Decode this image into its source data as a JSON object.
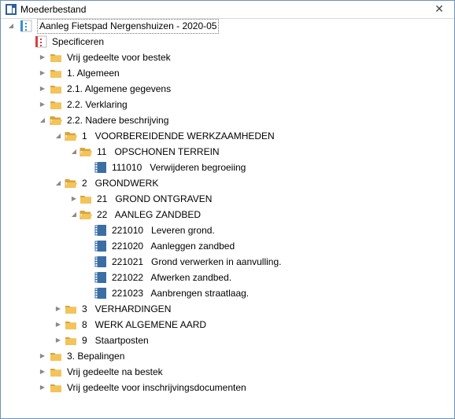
{
  "window": {
    "title": "Moederbestand",
    "close_glyph": "✕"
  },
  "tree": [
    {
      "id": "r0",
      "label": "Aanleg Fietspad Nergenshuizen - 2020-05",
      "icon": "project-doc-icon",
      "arrow": "expanded",
      "level": 0
    },
    {
      "id": "r1",
      "label": "Specificeren",
      "icon": "specification-icon",
      "arrow": "none",
      "level": 1
    },
    {
      "id": "r2",
      "label": "Vrij gedeelte voor bestek",
      "icon": "folder-icon",
      "arrow": "collapsed",
      "level": 2
    },
    {
      "id": "r3",
      "label": "1. Algemeen",
      "icon": "folder-icon",
      "arrow": "collapsed",
      "level": 2
    },
    {
      "id": "r4",
      "label": "2.1. Algemene gegevens",
      "icon": "folder-icon",
      "arrow": "collapsed",
      "level": 2
    },
    {
      "id": "r5",
      "label": "2.2. Verklaring",
      "icon": "folder-icon",
      "arrow": "collapsed",
      "level": 2
    },
    {
      "id": "r6",
      "label": "2.2. Nadere beschrijving",
      "icon": "folder-open-icon",
      "arrow": "expanded",
      "level": 2
    },
    {
      "id": "r7",
      "label": "1   VOORBEREIDENDE WERKZAAMHEDEN",
      "icon": "folder-open-icon",
      "arrow": "expanded",
      "level": 3
    },
    {
      "id": "r8",
      "label": "11   OPSCHONEN TERREIN",
      "icon": "folder-open-icon",
      "arrow": "expanded",
      "level": 4
    },
    {
      "id": "r9",
      "label": "111010   Verwijderen begroeiing",
      "icon": "spec-document-icon",
      "arrow": "none",
      "level": 5
    },
    {
      "id": "r10",
      "label": "2   GRONDWERK",
      "icon": "folder-open-icon",
      "arrow": "expanded",
      "level": 3
    },
    {
      "id": "r11",
      "label": "21   GROND ONTGRAVEN",
      "icon": "folder-icon",
      "arrow": "collapsed",
      "level": 4
    },
    {
      "id": "r12",
      "label": "22   AANLEG ZANDBED",
      "icon": "folder-open-icon",
      "arrow": "expanded",
      "level": 4
    },
    {
      "id": "r13",
      "label": "221010   Leveren grond.",
      "icon": "spec-document-icon",
      "arrow": "none",
      "level": 5
    },
    {
      "id": "r14",
      "label": "221020   Aanleggen zandbed",
      "icon": "spec-document-icon",
      "arrow": "none",
      "level": 5
    },
    {
      "id": "r15",
      "label": "221021   Grond verwerken in aanvulling.",
      "icon": "spec-document-icon",
      "arrow": "none",
      "level": 5
    },
    {
      "id": "r16",
      "label": "221022   Afwerken zandbed.",
      "icon": "spec-document-icon",
      "arrow": "none",
      "level": 5
    },
    {
      "id": "r17",
      "label": "221023   Aanbrengen straatlaag.",
      "icon": "spec-document-icon",
      "arrow": "none",
      "level": 5
    },
    {
      "id": "r18",
      "label": "3   VERHARDINGEN",
      "icon": "folder-icon",
      "arrow": "collapsed",
      "level": 3
    },
    {
      "id": "r19",
      "label": "8   WERK ALGEMENE AARD",
      "icon": "folder-icon",
      "arrow": "collapsed",
      "level": 3
    },
    {
      "id": "r20",
      "label": "9   Staartposten",
      "icon": "folder-icon",
      "arrow": "collapsed",
      "level": 3
    },
    {
      "id": "r21",
      "label": "3. Bepalingen",
      "icon": "folder-icon",
      "arrow": "collapsed",
      "level": 2
    },
    {
      "id": "r22",
      "label": "Vrij gedeelte na bestek",
      "icon": "folder-icon",
      "arrow": "collapsed",
      "level": 2
    },
    {
      "id": "r23",
      "label": "Vrij gedeelte voor inschrijvingsdocumenten",
      "icon": "folder-icon",
      "arrow": "collapsed",
      "level": 2
    }
  ],
  "colors": {
    "folder": "#f2c45a",
    "folder_dark": "#d9a43a",
    "doc_blue": "#3a6ea5",
    "spec_red": "#d84040"
  }
}
